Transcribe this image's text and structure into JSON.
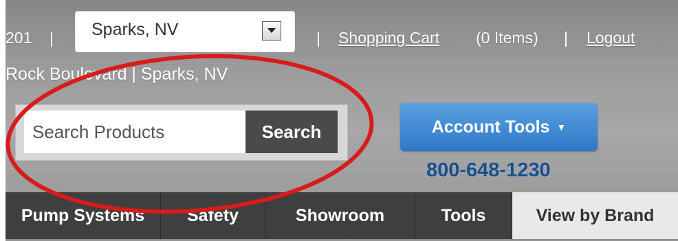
{
  "header": {
    "partial_number": "201",
    "location": {
      "selected": "Sparks, NV",
      "dropdown_icon": "dropdown-arrow-icon"
    },
    "separator": "|",
    "cart_link": "Shopping Cart",
    "cart_count": "(0 Items)",
    "logout_link": "Logout",
    "address": "Rock Boulevard | Sparks, NV"
  },
  "search": {
    "placeholder": "Search Products",
    "button_label": "Search"
  },
  "account": {
    "button_label": "Account Tools",
    "caret_icon": "caret-down-icon",
    "phone": "800-648-1230"
  },
  "nav": {
    "items": [
      {
        "label": "Pump Systems"
      },
      {
        "label": "Safety"
      },
      {
        "label": "Showroom"
      },
      {
        "label": "Tools"
      },
      {
        "label": "View by Brand"
      }
    ]
  },
  "colors": {
    "accent_blue": "#2f78c8",
    "phone_blue": "#16508f",
    "annotation_red": "#d81b1b",
    "nav_dark": "#3f3f3f"
  }
}
